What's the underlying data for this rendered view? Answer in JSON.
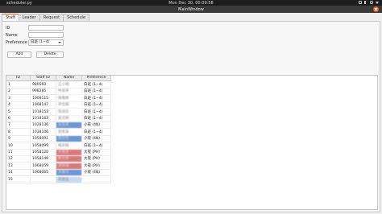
{
  "system_bar": {
    "app_name": "scheduler.py",
    "clock": "Mon Dec 30, 00:09:58"
  },
  "window": {
    "title": "MainWindow"
  },
  "tabs": [
    {
      "label": "Staff",
      "active": true
    },
    {
      "label": "Leader",
      "active": false
    },
    {
      "label": "Request",
      "active": false
    },
    {
      "label": "Schedule",
      "active": false
    }
  ],
  "form": {
    "id_label": "ID",
    "id_value": "",
    "name_label": "Name",
    "name_value": "",
    "preference_label": "Preference",
    "preference_value": "白班 (1~4)",
    "add_button": "Add",
    "delete_button": "Delete"
  },
  "table": {
    "columns": [
      "ID",
      "Staff ID",
      "Name",
      "Preference"
    ],
    "rows": [
      {
        "id": "1",
        "staff_id": "980560",
        "name": "王小明",
        "preference": "白班 (1~4)",
        "highlight": ""
      },
      {
        "id": "2",
        "staff_id": "998285",
        "name": "林美華",
        "preference": "白班 (1~4)",
        "highlight": ""
      },
      {
        "id": "3",
        "staff_id": "1008115",
        "name": "陳雅婷",
        "preference": "白班 (1~4)",
        "highlight": ""
      },
      {
        "id": "4",
        "staff_id": "1008147",
        "name": "李佳穎",
        "preference": "白班 (1~4)",
        "highlight": ""
      },
      {
        "id": "5",
        "staff_id": "1018153",
        "name": "張淑芬",
        "preference": "白班 (1~4)",
        "highlight": ""
      },
      {
        "id": "6",
        "staff_id": "1018163",
        "name": "黃志明",
        "preference": "白班 (1~4)",
        "highlight": ""
      },
      {
        "id": "7",
        "staff_id": "1028136",
        "name": "吳宜君",
        "preference": "小夜 (4N)",
        "highlight": "blue"
      },
      {
        "id": "8",
        "staff_id": "1038106",
        "name": "劉家豪",
        "preference": "白班 (1~4)",
        "highlight": ""
      },
      {
        "id": "9",
        "staff_id": "1058091",
        "name": "蔡欣怡",
        "preference": "小夜 (4N)",
        "highlight": "blue"
      },
      {
        "id": "10",
        "staff_id": "1058099",
        "name": "楊宗翰",
        "preference": "白班 (1~4)",
        "highlight": ""
      },
      {
        "id": "11",
        "staff_id": "1058120",
        "name": "許雅雯",
        "preference": "大夜 (PH)",
        "highlight": "red"
      },
      {
        "id": "12",
        "staff_id": "1058148",
        "name": "鄭文傑",
        "preference": "大夜 (PH)",
        "highlight": "red"
      },
      {
        "id": "13",
        "staff_id": "1068059",
        "name": "謝佩珊",
        "preference": "大夜 (PH)",
        "highlight": "red"
      },
      {
        "id": "14",
        "staff_id": "1068065",
        "name": "洪嘉玲",
        "preference": "小夜 (4N)",
        "highlight": "blue"
      },
      {
        "id": "15",
        "staff_id": "",
        "name": "郭彥廷",
        "preference": "",
        "highlight": "light"
      }
    ]
  },
  "colors": {
    "accent": "#e95420",
    "highlight_blue": "#6d97d4",
    "highlight_red": "#d97a7a"
  }
}
